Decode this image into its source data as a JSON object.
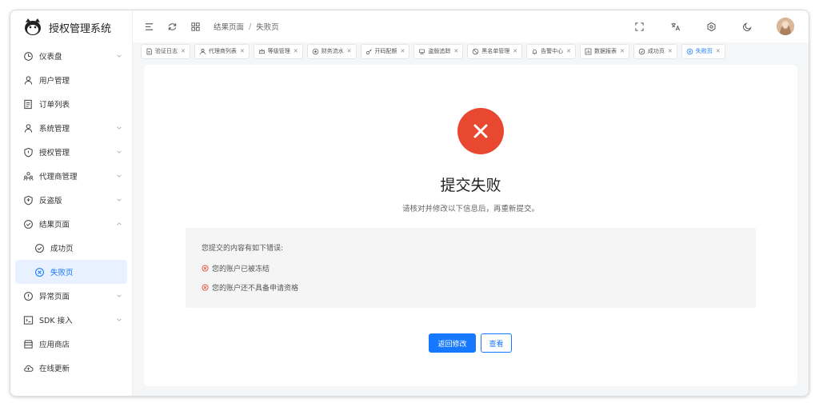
{
  "app": {
    "title": "授权管理系统"
  },
  "sidebar": {
    "items": [
      {
        "label": "仪表盘",
        "icon": "dashboard-icon",
        "expandable": true
      },
      {
        "label": "用户管理",
        "icon": "user-icon",
        "expandable": false
      },
      {
        "label": "订单列表",
        "icon": "list-icon",
        "expandable": false
      },
      {
        "label": "系统管理",
        "icon": "user-icon",
        "expandable": true
      },
      {
        "label": "授权管理",
        "icon": "shield-icon",
        "expandable": true
      },
      {
        "label": "代理商管理",
        "icon": "team-icon",
        "expandable": true
      },
      {
        "label": "反盗版",
        "icon": "shield-plus-icon",
        "expandable": true
      },
      {
        "label": "结果页面",
        "icon": "check-circle-icon",
        "expandable": true,
        "expanded": true
      },
      {
        "label": "成功页",
        "icon": "check-circle-icon",
        "sub": true
      },
      {
        "label": "失败页",
        "icon": "x-circle-icon",
        "sub": true,
        "active": true
      },
      {
        "label": "异常页面",
        "icon": "alert-circle-icon",
        "expandable": true
      },
      {
        "label": "SDK 接入",
        "icon": "code-icon",
        "expandable": true
      },
      {
        "label": "应用商店",
        "icon": "store-icon",
        "expandable": false
      },
      {
        "label": "在线更新",
        "icon": "cloud-icon",
        "expandable": false
      }
    ]
  },
  "header": {
    "breadcrumb": [
      "结果页面",
      "失败页"
    ]
  },
  "tabs": [
    {
      "label": "验证日志",
      "icon": "doc-icon"
    },
    {
      "label": "代理商列表",
      "icon": "user-icon"
    },
    {
      "label": "等级管理",
      "icon": "crown-icon"
    },
    {
      "label": "财务流水",
      "icon": "coin-icon"
    },
    {
      "label": "开码配额",
      "icon": "key-icon"
    },
    {
      "label": "盗版追踪",
      "icon": "scan-icon"
    },
    {
      "label": "黑名单管理",
      "icon": "ban-icon"
    },
    {
      "label": "告警中心",
      "icon": "bell-icon"
    },
    {
      "label": "数据报表",
      "icon": "chart-icon"
    },
    {
      "label": "成功页",
      "icon": "check-circle-icon"
    },
    {
      "label": "失败页",
      "icon": "x-circle-icon",
      "active": true
    }
  ],
  "result": {
    "title": "提交失败",
    "subtitle": "请核对并修改以下信息后，再重新提交。",
    "error_head": "您提交的内容有如下错误:",
    "errors": [
      "您的账户已被冻结",
      "您的账户还不具备申请资格"
    ],
    "primary_button": "返回修改",
    "secondary_button": "查看"
  },
  "colors": {
    "accent": "#1677ff",
    "error": "#e8482f",
    "active_bg": "#e8f1ff"
  }
}
